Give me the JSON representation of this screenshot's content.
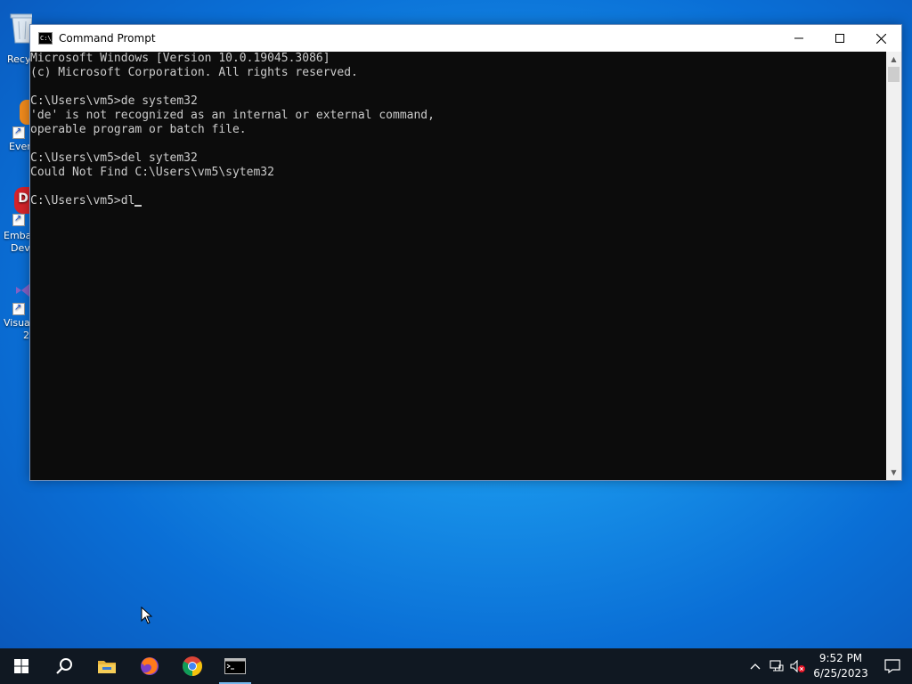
{
  "desktop": {
    "icons": [
      {
        "label": "Recy",
        "name": "Recycle Bin"
      },
      {
        "label": "Ever",
        "name": "Everything"
      },
      {
        "label1": "Emba",
        "label2": "Dev"
      },
      {
        "label1": "Visua",
        "label2": "2"
      }
    ]
  },
  "window": {
    "title": "Command Prompt",
    "minimize_icon": "minimize-icon",
    "maximize_icon": "maximize-icon",
    "close_icon": "close-icon"
  },
  "console": {
    "lines": [
      "Microsoft Windows [Version 10.0.19045.3086]",
      "(c) Microsoft Corporation. All rights reserved.",
      "",
      "C:\\Users\\vm5>de system32",
      "'de' is not recognized as an internal or external command,",
      "operable program or batch file.",
      "",
      "C:\\Users\\vm5>del sytem32",
      "Could Not Find C:\\Users\\vm5\\sytem32",
      ""
    ],
    "prompt": "C:\\Users\\vm5>",
    "input": "dl"
  },
  "taskbar": {
    "apps": [
      "start-icon",
      "search-icon",
      "file-explorer-icon",
      "firefox-icon",
      "chrome-icon",
      "command-prompt-icon"
    ],
    "active_app": "command-prompt-icon"
  },
  "tray": {
    "time": "9:52 PM",
    "date": "6/25/2023"
  },
  "colors": {
    "console_bg": "#0c0c0c",
    "console_fg": "#cccccc",
    "taskbar_bg": "#101822",
    "accent": "#76b9ed"
  }
}
